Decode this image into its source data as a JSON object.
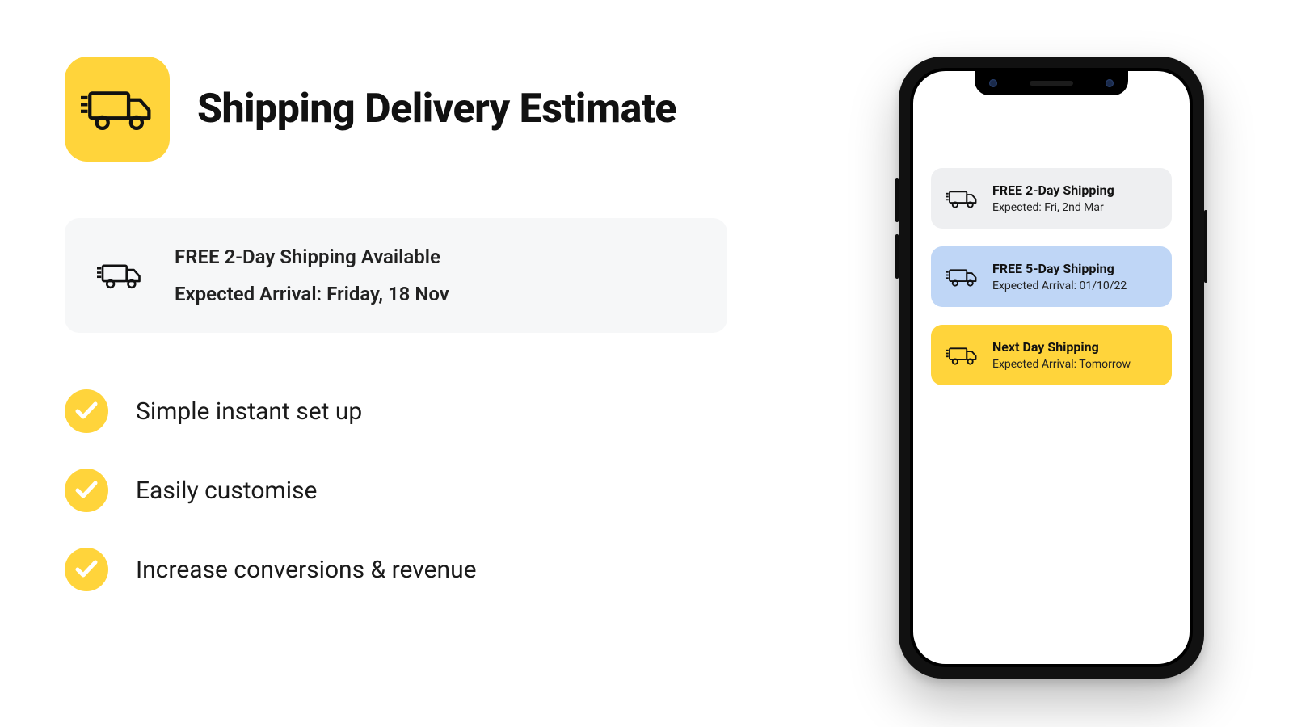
{
  "colors": {
    "accent": "#FFD43B",
    "blue": "#BFD6F6",
    "gray": "#EEEFF1"
  },
  "hero": {
    "icon_name": "truck-icon",
    "title": "Shipping Delivery Estimate"
  },
  "estimate_card": {
    "icon_name": "truck-icon",
    "line1": "FREE 2-Day Shipping Available",
    "line2": "Expected Arrival: Friday, 18 Nov"
  },
  "features": [
    {
      "label": "Simple instant set up"
    },
    {
      "label": "Easily customise"
    },
    {
      "label": "Increase conversions & revenue"
    }
  ],
  "phone": {
    "options": [
      {
        "bg": "gray",
        "title": "FREE 2-Day Shipping",
        "subtitle": "Expected: Fri, 2nd Mar"
      },
      {
        "bg": "blue",
        "title": "FREE 5-Day Shipping",
        "subtitle": "Expected Arrival: 01/10/22"
      },
      {
        "bg": "yellow",
        "title": "Next Day Shipping",
        "subtitle": "Expected Arrival: Tomorrow"
      }
    ]
  }
}
